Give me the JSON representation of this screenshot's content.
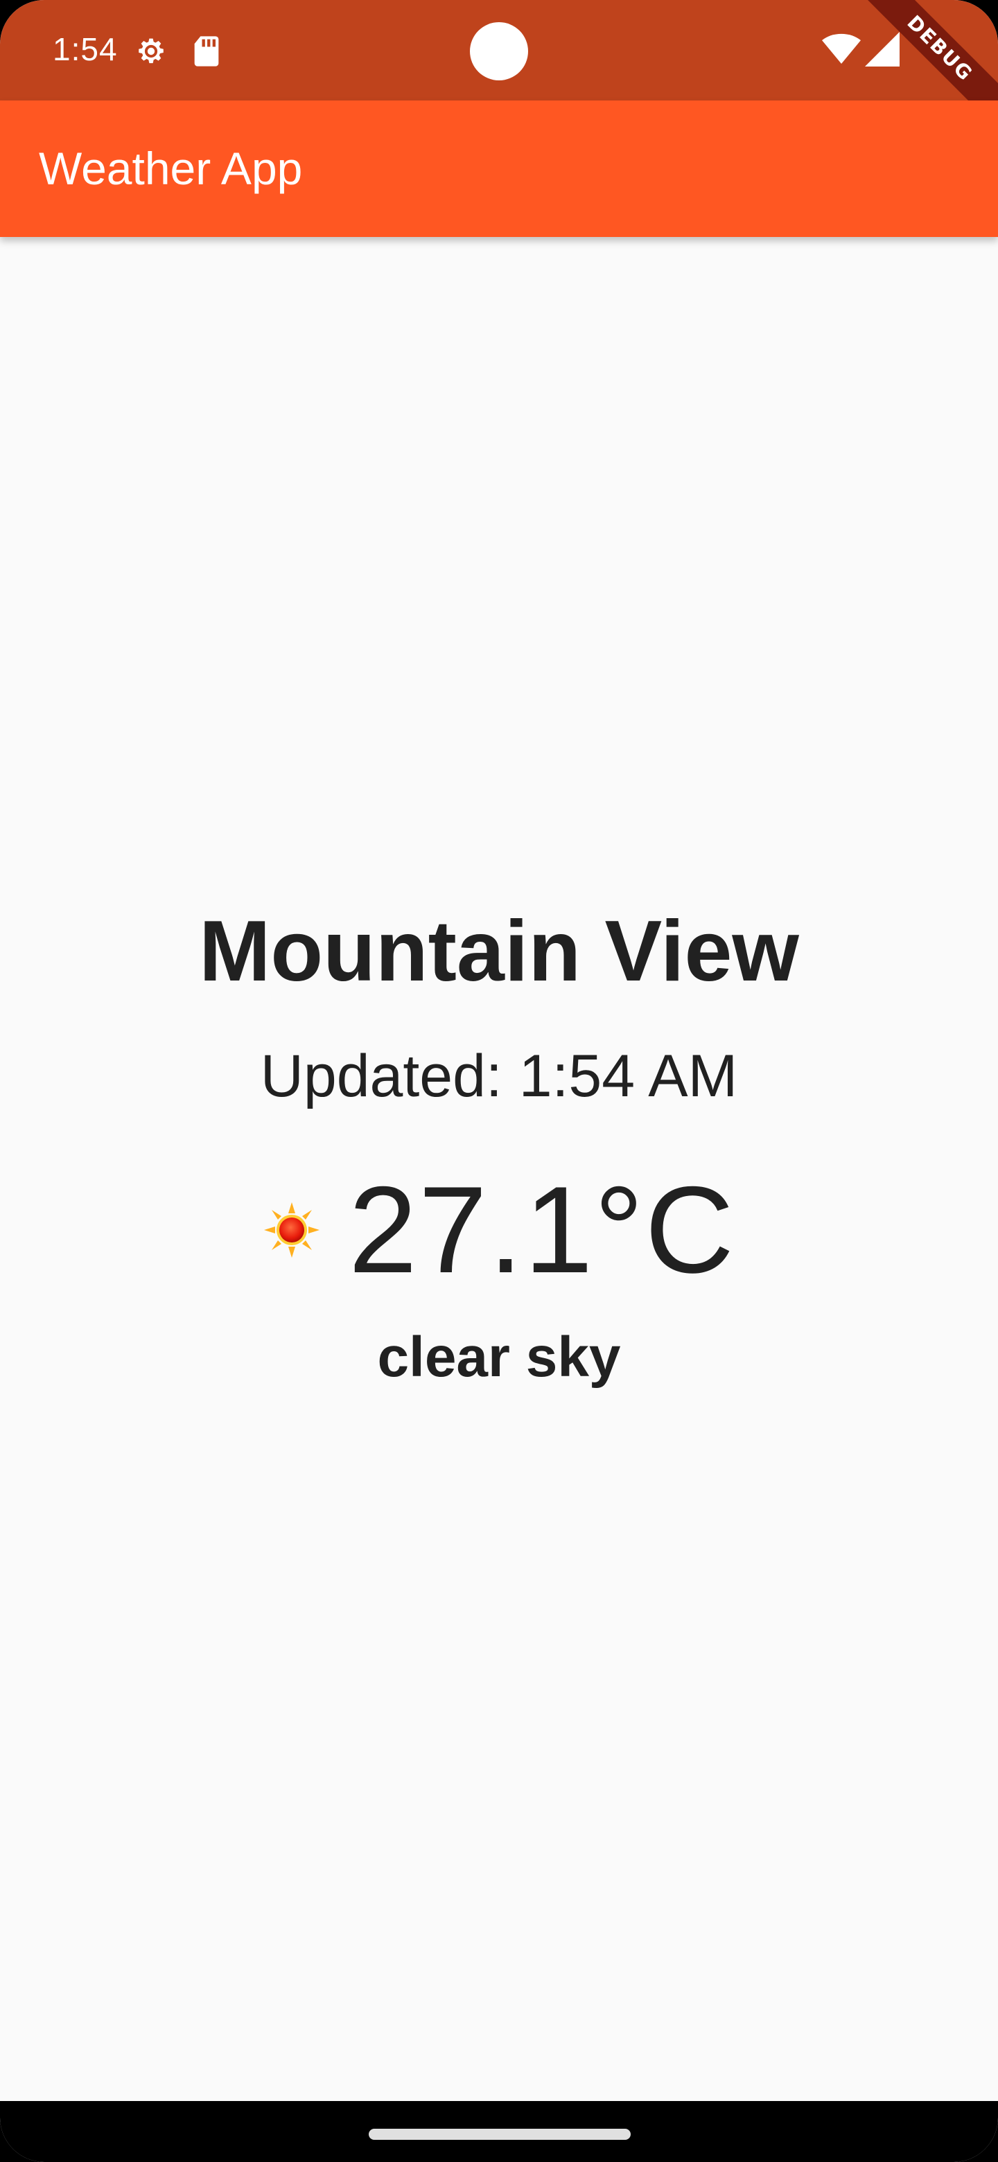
{
  "status_bar": {
    "time": "1:54",
    "icons": [
      "settings-gear-icon",
      "sd-card-icon",
      "wifi-icon",
      "cellular-signal-icon"
    ]
  },
  "debug_banner": {
    "label": "DEBUG"
  },
  "app_bar": {
    "title": "Weather App",
    "color": "#ff5722",
    "status_color": "#bf431c"
  },
  "weather": {
    "city": "Mountain View",
    "updated": "Updated: 1:54 AM",
    "icon": "sun-icon",
    "temperature": "27.1°C",
    "condition": "clear sky"
  }
}
